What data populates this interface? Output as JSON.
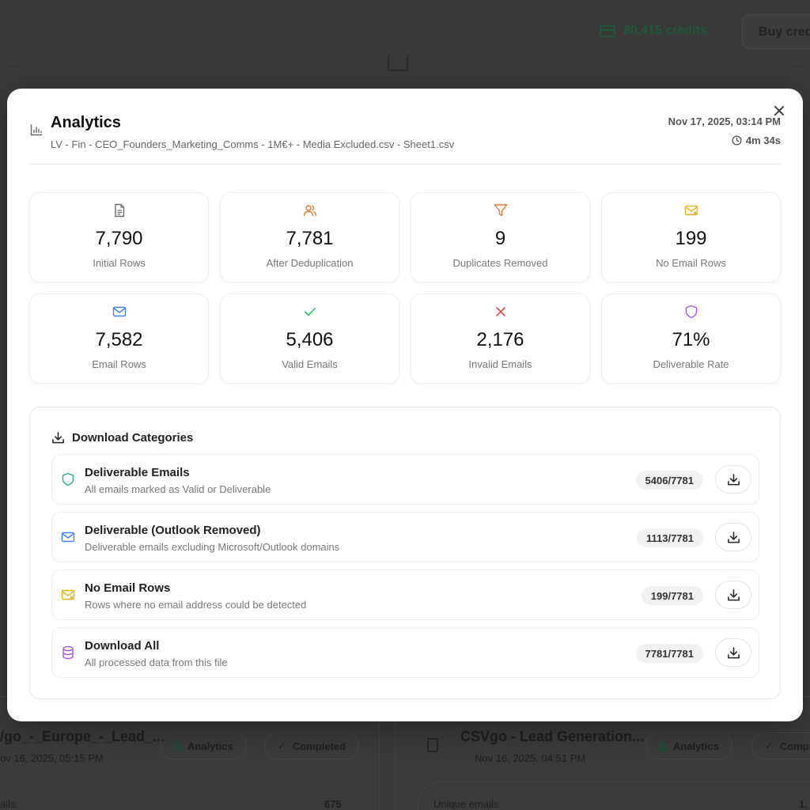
{
  "background": {
    "credits": "80,415 credits",
    "buy_label": "Buy cred",
    "left_card": {
      "title": "/go_-_Europe_-_Lead_...",
      "date": "ov 16, 2025, 05:15 PM",
      "analytics": "Analytics",
      "status": "Completed",
      "stat_label": "ails:",
      "stat_value": "675"
    },
    "right_card": {
      "title": "CSVgo - Lead Generation...",
      "date": "Nov 16, 2025, 04:51 PM",
      "analytics": "Analytics",
      "status": "Compl",
      "stat_label": "Unique emails:",
      "stat_value": "1,"
    }
  },
  "modal": {
    "title": "Analytics",
    "subtitle": "LV - Fin - CEO_Founders_Marketing_Comms - 1M€+ - Media Excluded.csv - Sheet1.csv",
    "datetime": "Nov 17, 2025, 03:14 PM",
    "duration": "4m 34s",
    "stats": [
      {
        "icon": "file-icon",
        "value": "7,790",
        "label": "Initial Rows",
        "color": "#6b6b6b"
      },
      {
        "icon": "users-icon",
        "value": "7,781",
        "label": "After Deduplication",
        "color": "#e8772e"
      },
      {
        "icon": "filter-icon",
        "value": "9",
        "label": "Duplicates Removed",
        "color": "#e8772e"
      },
      {
        "icon": "mail-x-icon",
        "value": "199",
        "label": "No Email Rows",
        "color": "#e6b31e"
      },
      {
        "icon": "mail-icon",
        "value": "7,582",
        "label": "Email Rows",
        "color": "#3b82f6"
      },
      {
        "icon": "check-icon",
        "value": "5,406",
        "label": "Valid Emails",
        "color": "#22c55e"
      },
      {
        "icon": "x-icon",
        "value": "2,176",
        "label": "Invalid Emails",
        "color": "#ef4444"
      },
      {
        "icon": "shield-icon",
        "value": "71%",
        "label": "Deliverable Rate",
        "color": "#a855f7"
      }
    ],
    "downloads": {
      "header": "Download Categories",
      "items": [
        {
          "icon": "shield-icon",
          "title": "Deliverable Emails",
          "desc": "All emails marked as Valid or Deliverable",
          "count": "5406/7781",
          "color": "#22b07d"
        },
        {
          "icon": "mail-icon",
          "title": "Deliverable (Outlook Removed)",
          "desc": "Deliverable emails excluding Microsoft/Outlook domains",
          "count": "1113/7781",
          "color": "#3b82f6"
        },
        {
          "icon": "mail-x-icon",
          "title": "No Email Rows",
          "desc": "Rows where no email address could be detected",
          "count": "199/7781",
          "color": "#e6b31e"
        },
        {
          "icon": "database-icon",
          "title": "Download All",
          "desc": "All processed data from this file",
          "count": "7781/7781",
          "color": "#a855f7"
        }
      ]
    }
  }
}
